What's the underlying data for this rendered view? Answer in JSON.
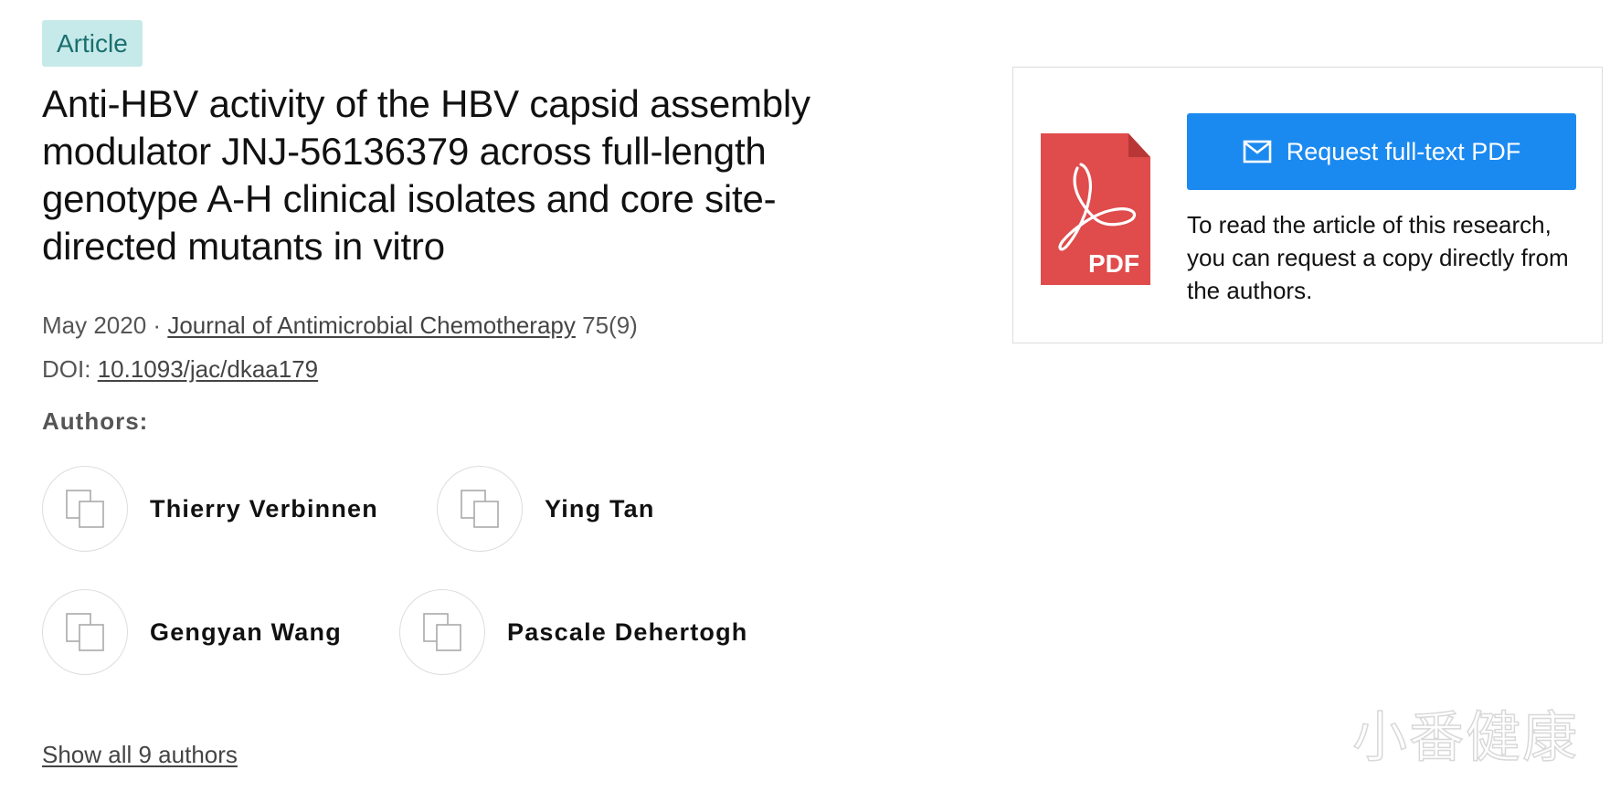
{
  "badge": "Article",
  "title": "Anti-HBV activity of the HBV capsid assembly modulator JNJ-56136379 across full-length genotype A-H clinical isolates and core site-directed mutants in vitro",
  "meta": {
    "date": "May 2020",
    "separator": "·",
    "journal": "Journal of Antimicrobial Chemotherapy",
    "volume": "75(9)",
    "doi_label": "DOI:",
    "doi": "10.1093/jac/dkaa179"
  },
  "authors_label": "Authors:",
  "authors": [
    {
      "name": "Thierry Verbinnen",
      "icon": "author-placeholder-icon"
    },
    {
      "name": "Ying Tan",
      "icon": "author-placeholder-icon"
    },
    {
      "name": "Gengyan Wang",
      "icon": "author-placeholder-icon"
    },
    {
      "name": "Pascale Dehertogh",
      "icon": "author-placeholder-icon"
    }
  ],
  "show_all": "Show all 9 authors",
  "pdf_card": {
    "icon": "pdf-file-icon",
    "icon_text": "PDF",
    "button_icon": "mail-icon",
    "button_label": "Request full-text PDF",
    "description": "To read the article of this research, you can request a copy directly from the authors."
  },
  "watermark": "小番健康",
  "colors": {
    "badge_bg": "#c6eae9",
    "badge_text": "#1a6f70",
    "button": "#1b8af0",
    "pdf_red": "#e04b4b"
  }
}
